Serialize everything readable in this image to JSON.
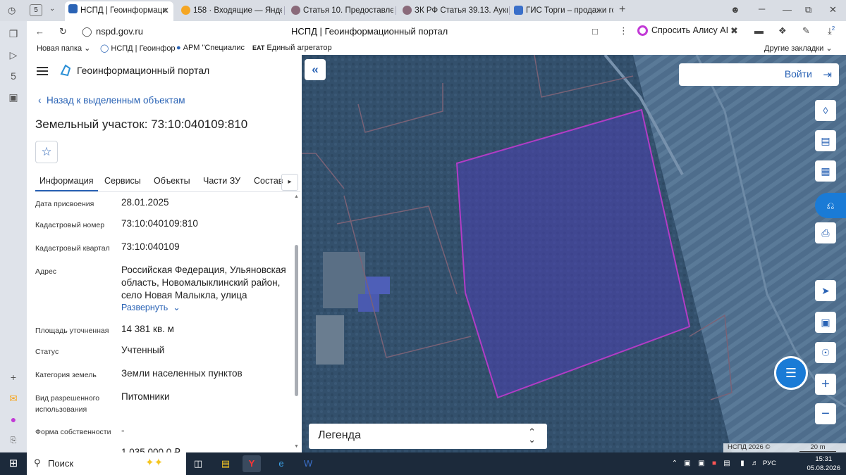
{
  "browser": {
    "tab_count": "5",
    "tabs": [
      {
        "label": "НСПД | Геоинформаци",
        "active": true
      },
      {
        "label": "158 · Входящие — Яндекс",
        "active": false
      },
      {
        "label": "Статья 10. Предоставлени",
        "active": false
      },
      {
        "label": "ЗК РФ Статья 39.13. Аукц",
        "active": false
      },
      {
        "label": "ГИС Торги – продажи гос",
        "active": false
      }
    ],
    "url": "nspd.gov.ru",
    "page_title": "НСПД | Геоинформационный портал",
    "alice": "Спросить Алису AI",
    "bookmarks": [
      "Новая папка",
      "НСПД | Геоинфор",
      "АРМ \"Специалис",
      "Единый агрегатор"
    ],
    "other_bookmarks": "Другие закладки"
  },
  "panel": {
    "portal_title": "Геоинформационный портал",
    "back_link": "Назад к выделенным объектам",
    "title": "Земельный участок: 73:10:040109:810",
    "tabs": [
      "Информация",
      "Сервисы",
      "Объекты",
      "Части ЗУ",
      "Состав"
    ],
    "fields": [
      {
        "label": "Дата присвоения",
        "value": "28.01.2025"
      },
      {
        "label": "Кадастровый номер",
        "value": "73:10:040109:810"
      },
      {
        "label": "Кадастровый квартал",
        "value": "73:10:040109"
      },
      {
        "label": "Адрес",
        "value": "Российская Федерация, Ульяновская область, Новомалыклинский район, село Новая Малыкла, улица"
      },
      {
        "label": "Площадь уточненная",
        "value": "14 381 кв. м"
      },
      {
        "label": "Статус",
        "value": "Учтенный"
      },
      {
        "label": "Категория земель",
        "value": "Земли населенных пунктов"
      },
      {
        "label": "Вид разрешенного использования",
        "value": "Питомники"
      },
      {
        "label": "Форма собственности",
        "value": "-"
      }
    ],
    "expand_link": "Развернуть",
    "cut_value": "1 035 000,0 ₽"
  },
  "map": {
    "login": "Войти",
    "legend": "Легенда",
    "copyright": "НСПД 2026 ©",
    "scale": "20 m",
    "notification_count": "2",
    "plot_outline_color": "#b23cc6",
    "plot_fill_color": "#4a3fb0"
  },
  "taskbar": {
    "search": "Поиск",
    "lang": "РУС",
    "time": "15:31",
    "date": "05.08.2026"
  }
}
